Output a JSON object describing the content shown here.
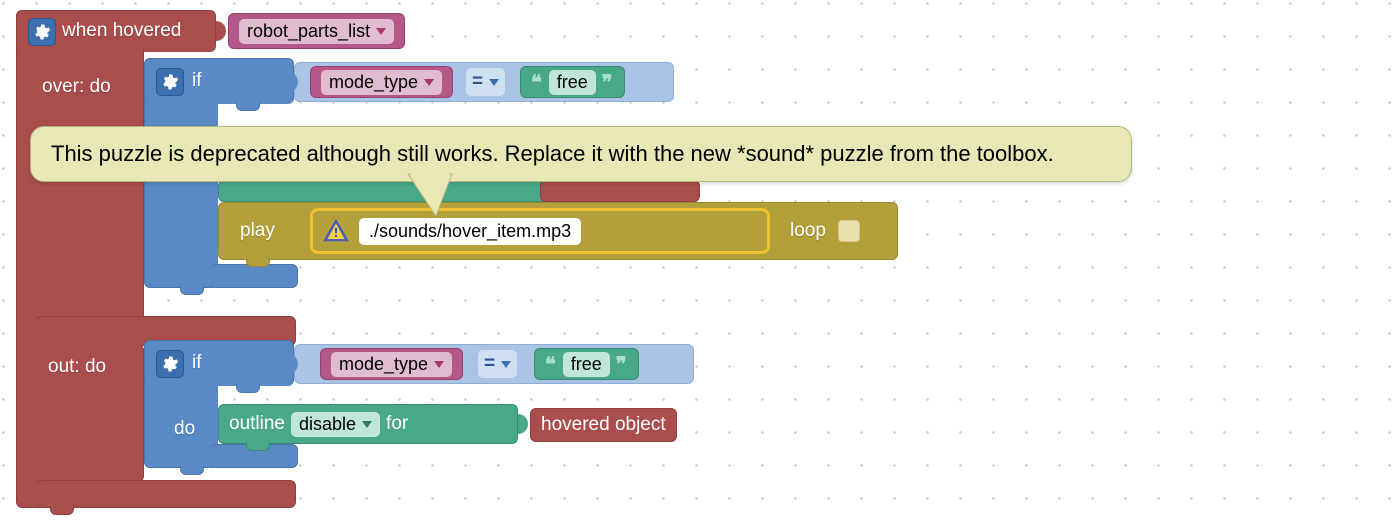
{
  "tooltip": {
    "text": "This puzzle is deprecated although still works. Replace it with the new *sound* puzzle from the toolbox."
  },
  "event": {
    "label": "when hovered",
    "target_var": "robot_parts_list",
    "over_label": "over: do",
    "out_label": "out: do"
  },
  "if_block": {
    "label": "if",
    "do_label": "do",
    "var": "mode_type",
    "op": "=",
    "literal": "free"
  },
  "play_block": {
    "label": "play",
    "path": "./sounds/hover_item.mp3",
    "loop_label": "loop",
    "loop_checked": false
  },
  "outline_block": {
    "label_pre": "outline",
    "mode": "disable",
    "label_post": "for",
    "target": "hovered object"
  }
}
